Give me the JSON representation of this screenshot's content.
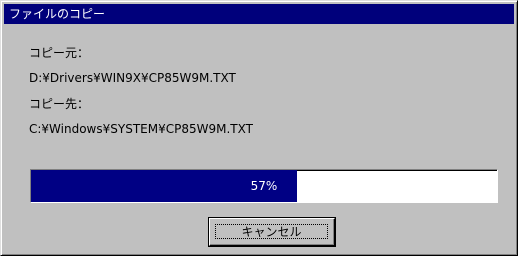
{
  "window": {
    "title": "ファイルのコピー"
  },
  "copy": {
    "source_label": "コピー元：",
    "source_path": "D:¥Drivers¥WIN9X¥CP85W9M.TXT",
    "dest_label": "コピー先：",
    "dest_path": "C:¥Windows¥SYSTEM¥CP85W9M.TXT"
  },
  "progress": {
    "percent": 57,
    "text": "57%"
  },
  "buttons": {
    "cancel_label": "キャンセル"
  },
  "colors": {
    "titlebar": "#00007b",
    "progress_fill": "#000084",
    "dialog_face": "#c0c0c0"
  }
}
